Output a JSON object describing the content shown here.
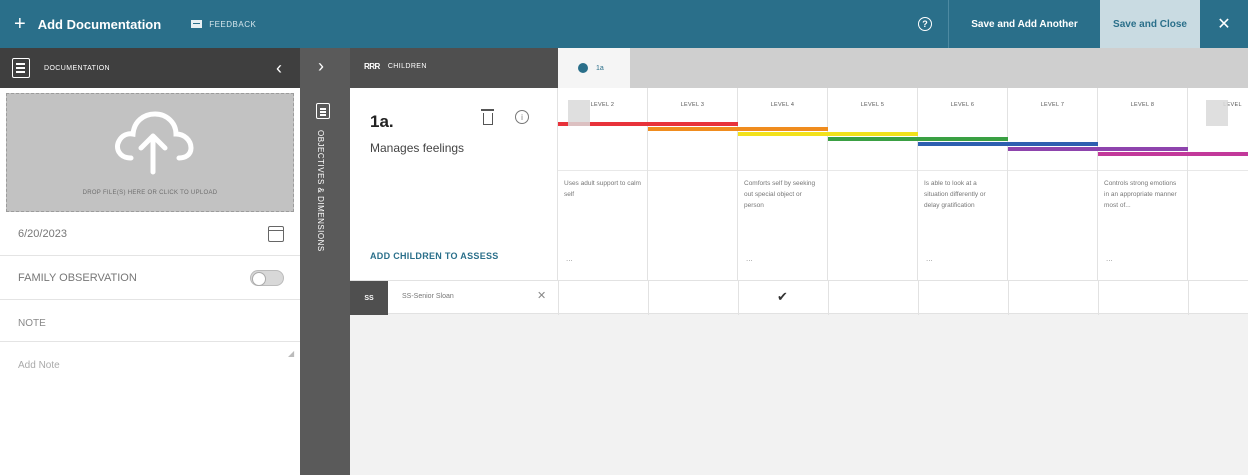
{
  "topbar": {
    "add_label": "Add Documentation",
    "feedback_label": "FEEDBACK",
    "help_glyph": "?",
    "save_another_label": "Save and Add Another",
    "save_close_label": "Save and Close",
    "close_glyph": "✕",
    "color": "#2a6f8a"
  },
  "left_panel": {
    "title": "DOCUMENTATION",
    "collapse_glyph": "‹",
    "upload_text": "DROP FILE(S) HERE OR CLICK TO UPLOAD",
    "date_value": "6/20/2023",
    "family_observation_label": "FAMILY OBSERVATION",
    "family_observation_on": false,
    "note_label": "NOTE",
    "note_placeholder": "Add Note"
  },
  "rail": {
    "expand_glyph": "›",
    "vertical_label": "OBJECTIVES & DIMENSIONS"
  },
  "main": {
    "children_icon": "RRR",
    "children_label": "CHILDREN",
    "active_tab": "1a",
    "objective": {
      "code": "1a.",
      "name": "Manages feelings",
      "add_children_label": "ADD CHILDREN TO ASSESS"
    },
    "levels": [
      {
        "label": "LEVEL 2",
        "desc": "Uses adult support to calm self",
        "more": "..."
      },
      {
        "label": "LEVEL 3",
        "desc": "",
        "more": ""
      },
      {
        "label": "LEVEL 4",
        "desc": "Comforts self by seeking out special object or person",
        "more": "..."
      },
      {
        "label": "LEVEL 5",
        "desc": "",
        "more": ""
      },
      {
        "label": "LEVEL 6",
        "desc": "Is able to look at a situation differently or delay gratification",
        "more": "..."
      },
      {
        "label": "LEVEL 7",
        "desc": "",
        "more": ""
      },
      {
        "label": "LEVEL 8",
        "desc": "Controls strong emotions in an appropriate manner most of...",
        "more": "..."
      },
      {
        "label": "LEVEL",
        "desc": "",
        "more": ""
      }
    ],
    "band_colors": [
      "#e8323a",
      "#f08c1e",
      "#f2e21b",
      "#3aa043",
      "#2e5fb0",
      "#8e44ad",
      "#c2399a"
    ],
    "child": {
      "initials": "SS",
      "name": "SS-Senior Sloan",
      "remove_glyph": "✕",
      "checked_level_index": 2,
      "check_glyph": "✔"
    }
  }
}
